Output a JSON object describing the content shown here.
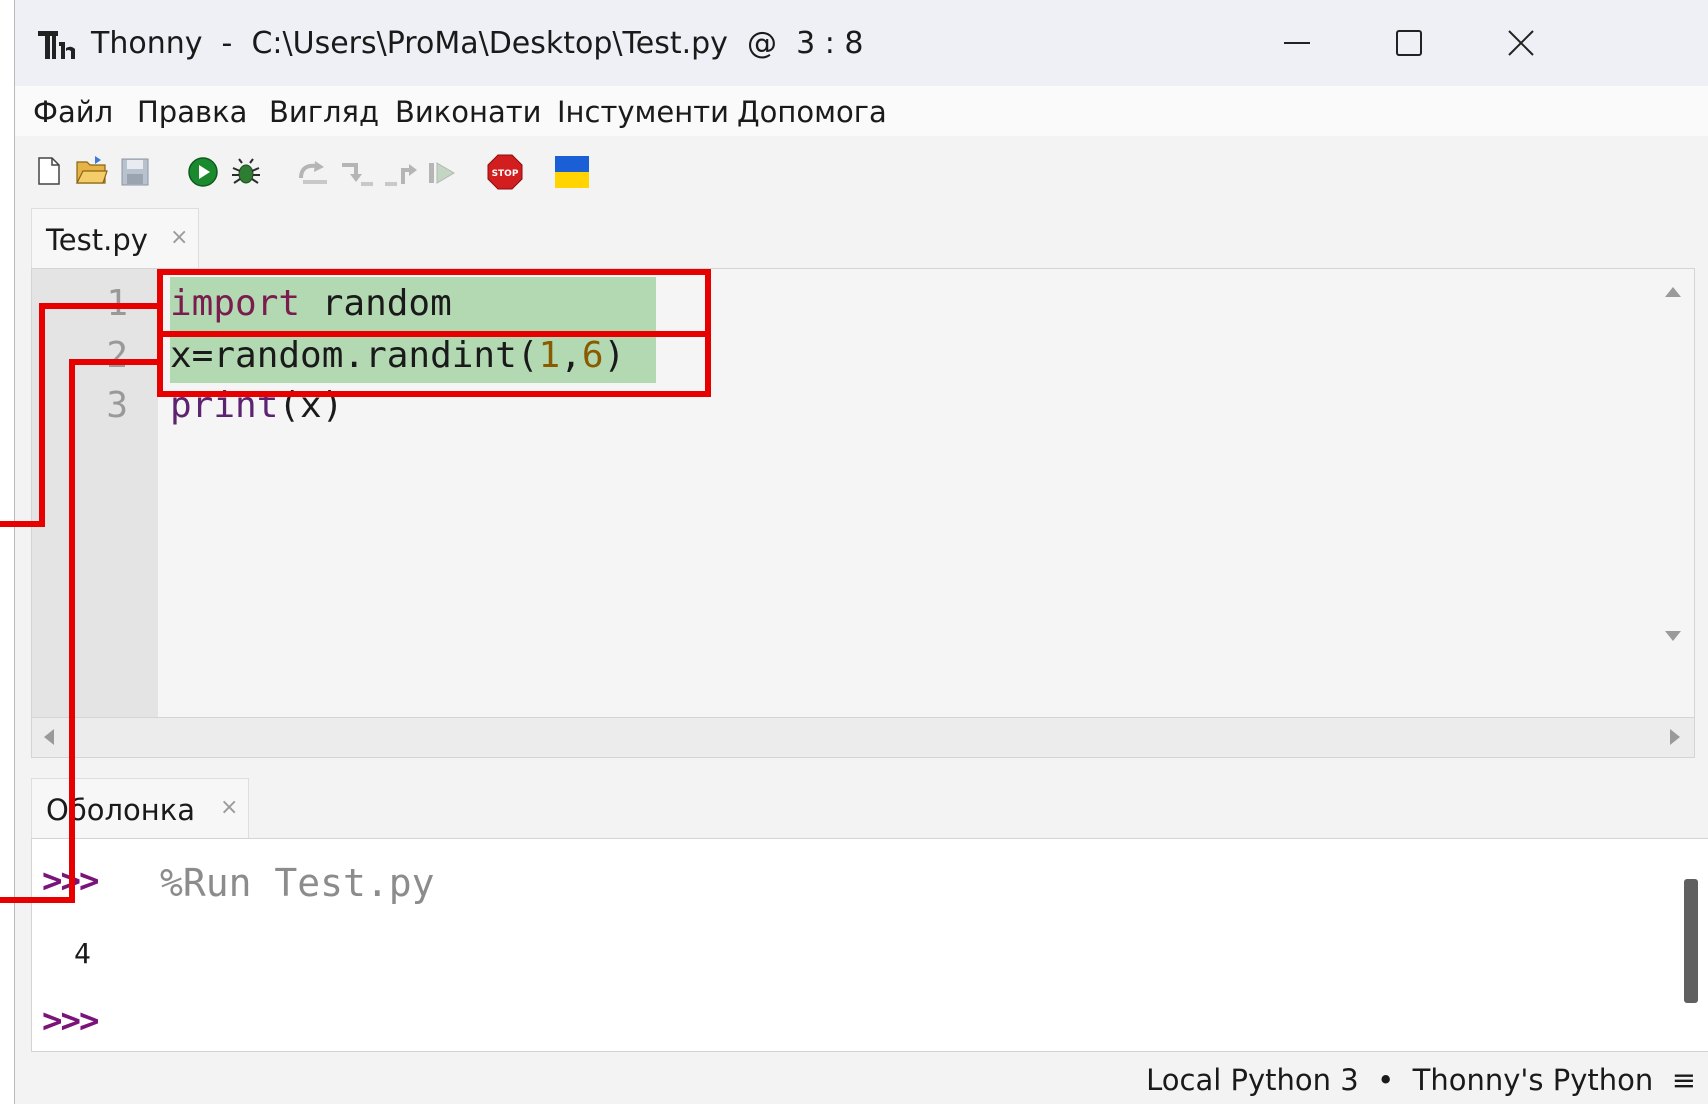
{
  "window": {
    "title": "Thonny  -  C:\\Users\\ProMa\\Desktop\\Test.py  @  3 : 8",
    "minimize_symbol": "—",
    "maximize_symbol": "□",
    "close_symbol": "✕"
  },
  "menu": {
    "items": [
      "Файл",
      "Правка",
      "Вигляд",
      "Виконати",
      "Інстументи",
      "Допомога"
    ]
  },
  "toolbar": {
    "icons": [
      "new-file-icon",
      "open-file-icon",
      "save-file-icon",
      "run-icon",
      "debug-icon",
      "step-over-icon",
      "step-into-icon",
      "step-out-icon",
      "resume-icon",
      "stop-icon",
      "ukraine-flag-icon"
    ]
  },
  "editor": {
    "tab_label": "Test.py",
    "tab_close": "×",
    "line_numbers": [
      "1",
      "2",
      "3"
    ],
    "line1": {
      "kw": "import",
      "rest": " random"
    },
    "line2": {
      "prefix": "x=random.randint(",
      "n1": "1",
      "comma": ",",
      "n2": "6",
      "suffix": ")"
    },
    "line3": {
      "fn": "print",
      "rest": "(x)"
    },
    "highlight_color": "#b3d9b3"
  },
  "shell": {
    "tab_label": "Оболонка",
    "tab_close": "×",
    "prompt": ">>>",
    "command": "%Run Test.py",
    "output": "4"
  },
  "status": {
    "text": "Local Python 3  •  Thonny's Python  ≡"
  },
  "annotation": {
    "color": "#e60000"
  }
}
